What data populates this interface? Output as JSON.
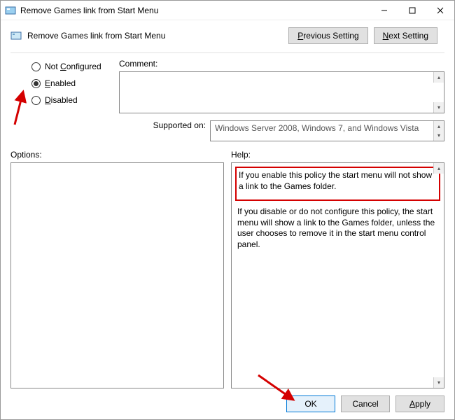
{
  "title": "Remove Games link from Start Menu",
  "header": {
    "label": "Remove Games link from Start Menu"
  },
  "nav": {
    "prev": "Previous Setting",
    "next": "Next Setting"
  },
  "state": {
    "not_configured": "Not Configured",
    "enabled": "Enabled",
    "disabled": "Disabled",
    "selected": "enabled"
  },
  "labels": {
    "comment": "Comment:",
    "supported_on": "Supported on:",
    "options": "Options:",
    "help": "Help:"
  },
  "supported": "Windows Server 2008, Windows 7, and Windows Vista",
  "help": {
    "p1": "If you enable this policy the start menu will not show a link to the Games folder.",
    "p2": "If you disable or do not configure this policy, the start menu will show a link to the Games folder, unless the user chooses to remove it in the start menu control panel."
  },
  "buttons": {
    "ok": "OK",
    "cancel": "Cancel",
    "apply": "Apply"
  }
}
